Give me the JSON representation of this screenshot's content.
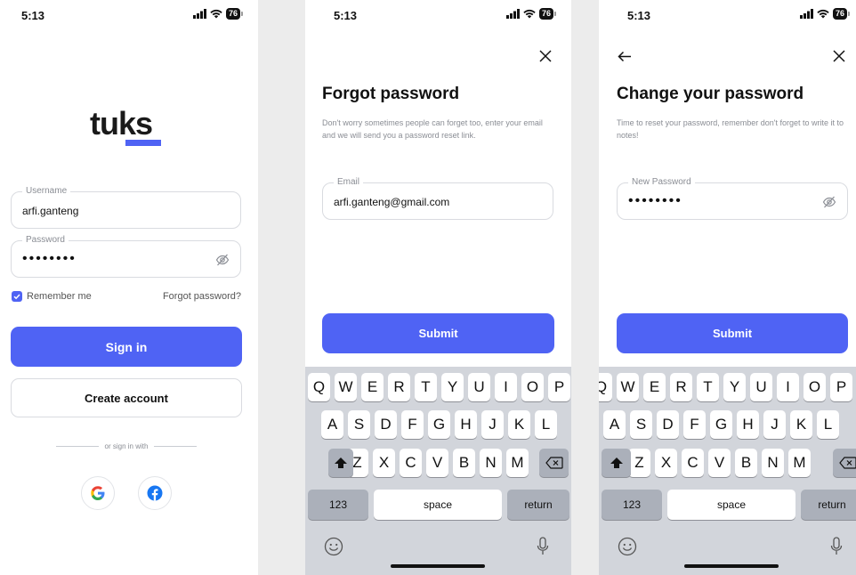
{
  "colors": {
    "accent": "#4f63f4",
    "gray_bg": "#ececec"
  },
  "status_bar": {
    "time": "5:13",
    "battery": "76"
  },
  "login": {
    "logo": "tuks",
    "username": {
      "label": "Username",
      "value": "arfi.ganteng"
    },
    "password": {
      "label": "Password",
      "value": "••••••••"
    },
    "remember_label": "Remember me",
    "remember_checked": true,
    "forgot_link": "Forgot password?",
    "sign_in": "Sign in",
    "create_account": "Create account",
    "divider_text": "or sign in with",
    "social": [
      "google-icon",
      "facebook-icon"
    ]
  },
  "forgot": {
    "title": "Forgot password",
    "description": "Don't worry sometimes people can forget too, enter your email and we will send you a password reset link.",
    "email_label": "Email",
    "email_value": "arfi.ganteng@gmail.com",
    "submit": "Submit"
  },
  "change": {
    "title": "Change your password",
    "description": "Time to reset your password, remember don't forget to write it to notes!",
    "password_label": "New Password",
    "password_value": "••••••••",
    "submit": "Submit"
  },
  "keyboard": {
    "row1": [
      "Q",
      "W",
      "E",
      "R",
      "T",
      "Y",
      "U",
      "I",
      "O",
      "P"
    ],
    "row2": [
      "A",
      "S",
      "D",
      "F",
      "G",
      "H",
      "J",
      "K",
      "L"
    ],
    "row3": [
      "Z",
      "X",
      "C",
      "V",
      "B",
      "N",
      "M"
    ],
    "numbers": "123",
    "space": "space",
    "return": "return"
  }
}
